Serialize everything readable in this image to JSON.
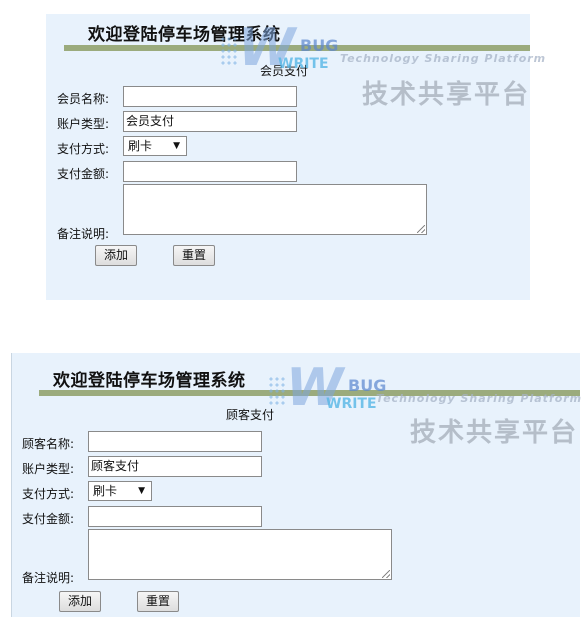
{
  "form1": {
    "title": "欢迎登陆停车场管理系统",
    "subtitle": "会员支付",
    "name_label": "会员名称:",
    "name_value": "",
    "type_label": "账户类型:",
    "type_value": "会员支付",
    "method_label": "支付方式:",
    "method_value": "刷卡",
    "amount_label": "支付金额:",
    "amount_value": "",
    "note_label": "备注说明:",
    "add_label": "添加",
    "reset_label": "重置"
  },
  "form2": {
    "title": "欢迎登陆停车场管理系统",
    "subtitle": "顾客支付",
    "name_label": "顾客名称:",
    "name_value": "",
    "type_label": "账户类型:",
    "type_value": "顾客支付",
    "method_label": "支付方式:",
    "method_value": "刷卡",
    "amount_label": "支付金额:",
    "amount_value": "",
    "note_label": "备注说明:",
    "add_label": "添加",
    "reset_label": "重置"
  },
  "watermark": {
    "tagline": "Technology Sharing Platform",
    "brand_cn": "技术共享平台",
    "bug": "BUG",
    "write": "WRITE",
    "w": "W"
  },
  "icons": {
    "dropdown": "chevron-down-icon",
    "resize": "resize-grip-icon"
  }
}
